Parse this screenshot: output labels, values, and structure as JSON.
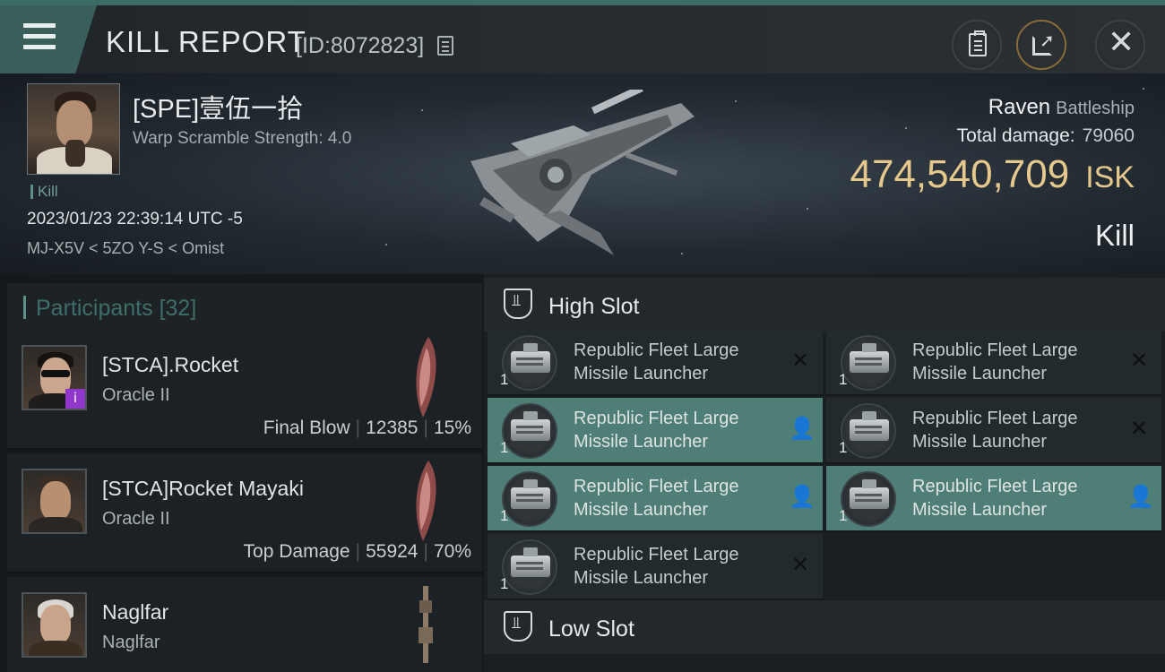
{
  "header": {
    "title": "KILL REPORT",
    "report_id": "[ID:8072823]"
  },
  "victim": {
    "name": "[SPE]壹伍一拾",
    "warp_scramble": "Warp Scramble Strength: 4.0",
    "tag": "Kill",
    "timestamp": "2023/01/23 22:39:14 UTC -5",
    "location": "MJ-X5V < 5ZO Y-S < Omist",
    "ship_name": "Raven",
    "ship_class": "Battleship",
    "total_damage_label": "Total damage:",
    "total_damage": "79060",
    "isk_value": "474,540,709",
    "isk_unit": "ISK",
    "result": "Kill"
  },
  "participants": {
    "title": "Participants",
    "count": "[32]",
    "items": [
      {
        "name": "[STCA].Rocket",
        "ship": "Oracle II",
        "role": "Final Blow",
        "damage": "12385",
        "percent": "15%"
      },
      {
        "name": "[STCA]Rocket Mayaki",
        "ship": "Oracle II",
        "role": "Top Damage",
        "damage": "55924",
        "percent": "70%"
      },
      {
        "name": "Naglfar",
        "ship": "Naglfar"
      }
    ]
  },
  "fitting": {
    "high_slot_title": "High Slot",
    "low_slot_title": "Low Slot",
    "high_modules": [
      {
        "name_line1": "Republic Fleet Large",
        "name_line2": "Missile Launcher",
        "qty": "1",
        "state": "destroyed",
        "state_icon": "close-icon"
      },
      {
        "name_line1": "Republic Fleet Large",
        "name_line2": "Missile Launcher",
        "qty": "1",
        "state": "destroyed",
        "state_icon": "close-icon"
      },
      {
        "name_line1": "Republic Fleet Large",
        "name_line2": "Missile Launcher",
        "qty": "1",
        "state": "dropped",
        "state_icon": "person-icon"
      },
      {
        "name_line1": "Republic Fleet Large",
        "name_line2": "Missile Launcher",
        "qty": "1",
        "state": "destroyed",
        "state_icon": "close-icon"
      },
      {
        "name_line1": "Republic Fleet Large",
        "name_line2": "Missile Launcher",
        "qty": "1",
        "state": "dropped",
        "state_icon": "person-icon"
      },
      {
        "name_line1": "Republic Fleet Large",
        "name_line2": "Missile Launcher",
        "qty": "1",
        "state": "dropped",
        "state_icon": "person-icon"
      },
      {
        "name_line1": "Republic Fleet Large",
        "name_line2": "Missile Launcher",
        "qty": "1",
        "state": "destroyed",
        "state_icon": "close-icon"
      }
    ]
  },
  "colors": {
    "accent": "#5e8f87",
    "dropped_bg": "#4f7e77",
    "isk": "#e6c88c",
    "badge": "#8e37c9"
  }
}
